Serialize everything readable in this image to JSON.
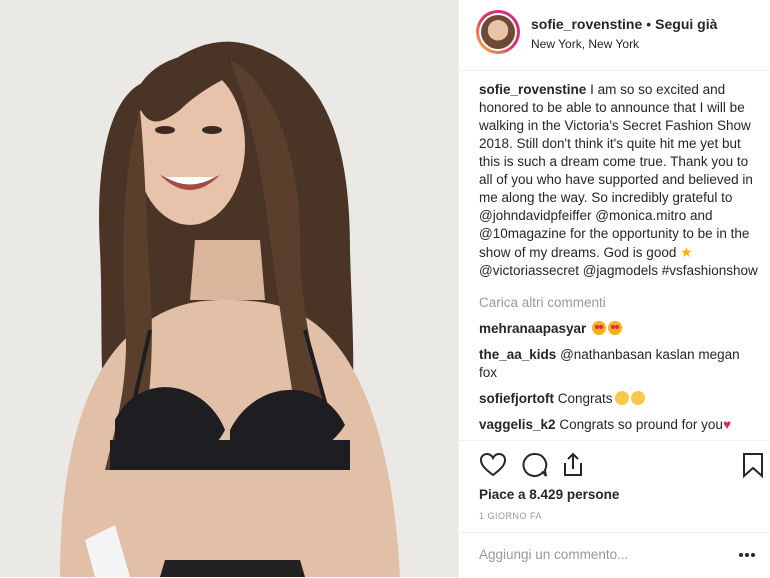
{
  "header": {
    "username": "sofie_rovenstine",
    "separator": "•",
    "follow_label": "Segui già",
    "location": "New York, New York"
  },
  "caption": {
    "username": "sofie_rovenstine",
    "text": "I am so so excited and honored to be able to announce that I will be walking in the Victoria's Secret Fashion Show 2018. Still don't think it's quite hit me yet but this is such a dream come true. Thank you to all of you who have supported and believed in me along the way. So incredibly grateful to @johndavidpfeiffer @monica.mitro and @10magazine for the opportunity to be in the show of my dreams. God is good",
    "tags": "@victoriassecret @jagmodels #vsfashionshow"
  },
  "load_more_label": "Carica altri commenti",
  "comments": [
    {
      "username": "mehranaapasyar",
      "text": ""
    },
    {
      "username": "the_aa_kids",
      "text": "@nathanbasan kaslan megan fox"
    },
    {
      "username": "sofiefjortoft",
      "text": "Congrats"
    },
    {
      "username": "vaggelis_k2",
      "text": "Congrats so pround for you"
    }
  ],
  "actions": {
    "like_icon": "heart-icon",
    "comment_icon": "comment-icon",
    "share_icon": "share-icon",
    "save_icon": "bookmark-icon"
  },
  "likes_text": "Piace a 8.429 persone",
  "time_text": "1 GIORNO FA",
  "add_comment_placeholder": "Aggiungi un commento...",
  "colors": {
    "text": "#262626",
    "muted": "#999999",
    "border": "#efefef",
    "heart": "#e0245e"
  }
}
